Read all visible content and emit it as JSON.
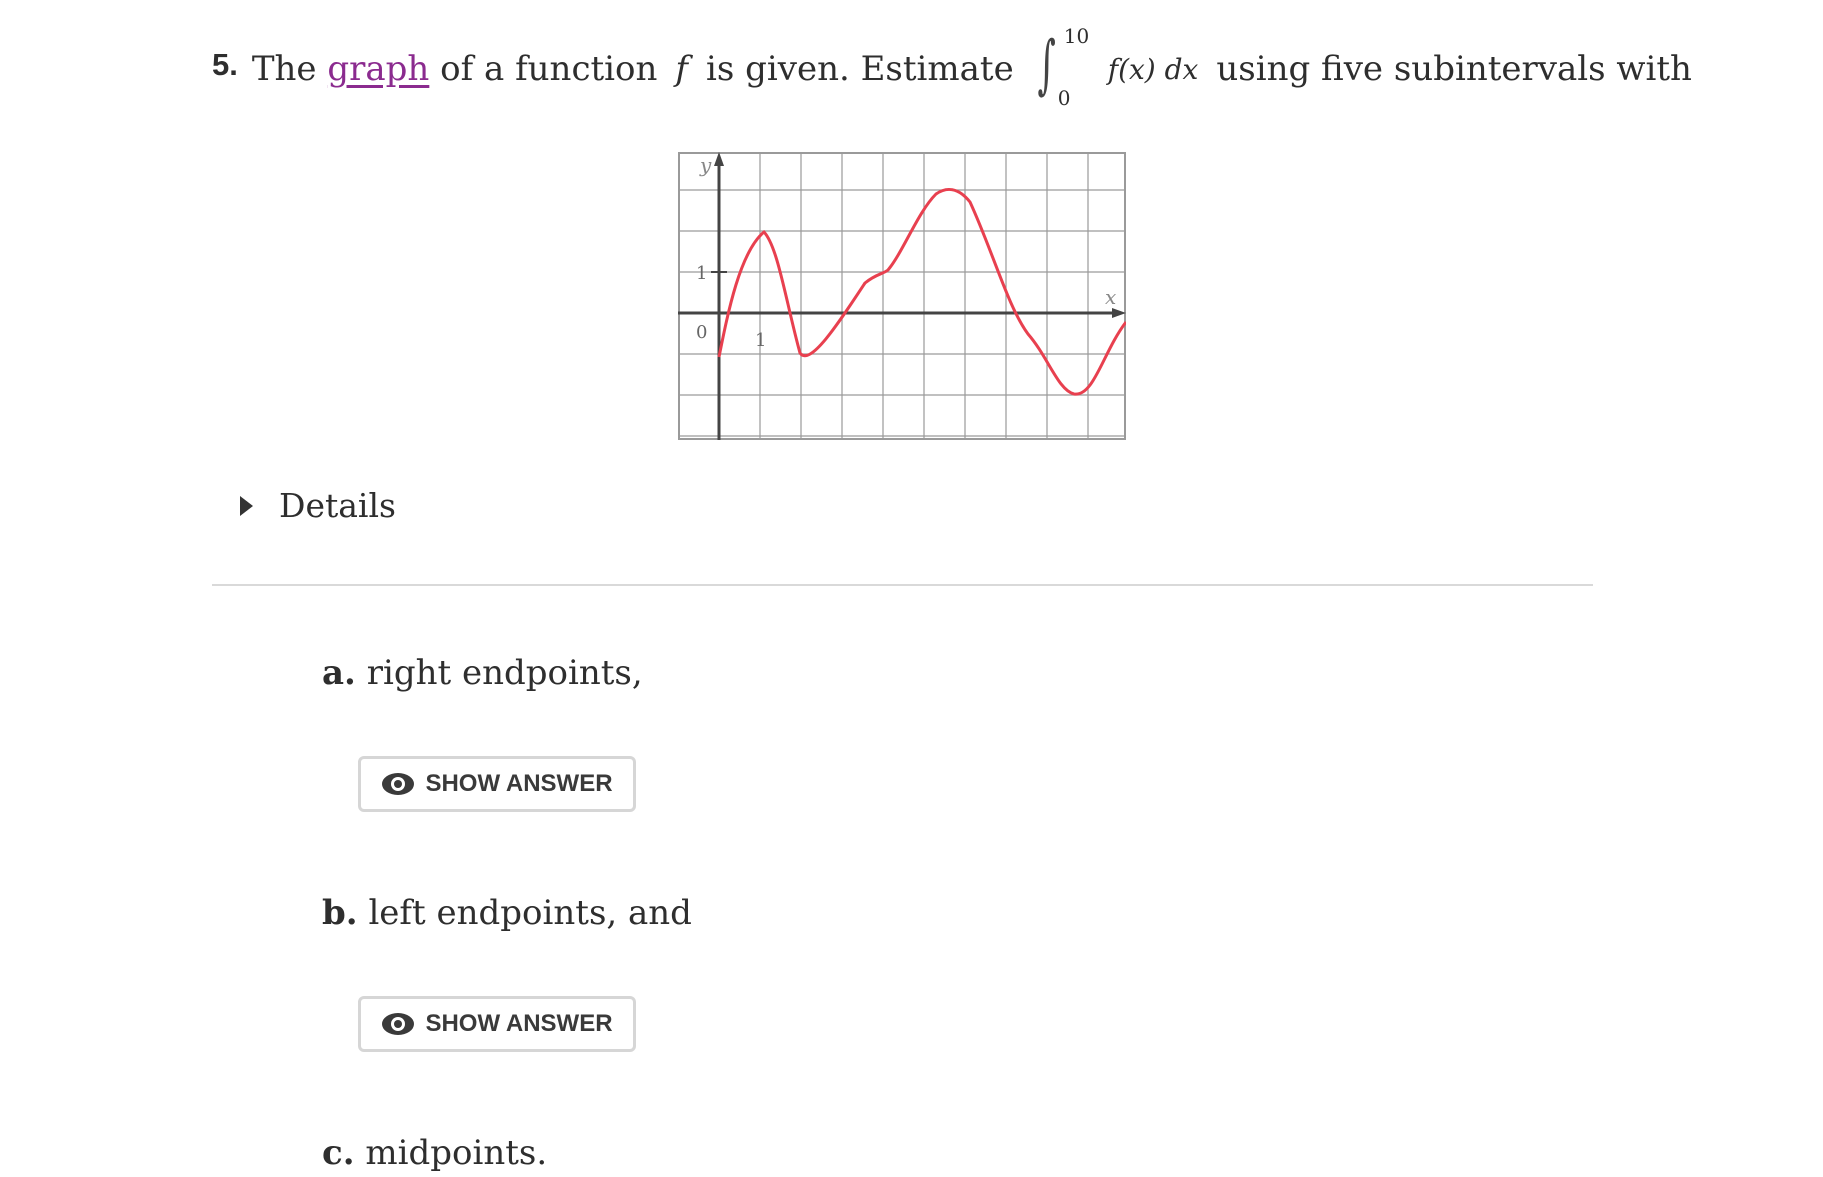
{
  "question": {
    "number": "5.",
    "text_before_link": "The",
    "link_text": "graph",
    "text_after_link": "of a function",
    "function_symbol": "f",
    "text_is_given": "is given. Estimate",
    "integral_upper": "10",
    "integral_lower": "0",
    "integrand": "f(x) dx",
    "text_end": "using five subintervals with"
  },
  "figure": {
    "y_axis_label": "y",
    "x_axis_label": "x",
    "y_tick_label": "1",
    "origin_label": "0",
    "x_tick_label": "1",
    "curve_color": "#e8404f",
    "grid_color": "#9a9a9a"
  },
  "details": {
    "label": "Details"
  },
  "parts": {
    "a": {
      "letter": "a.",
      "text": "right endpoints,"
    },
    "b": {
      "letter": "b.",
      "text": "left endpoints, and"
    },
    "c": {
      "letter": "c.",
      "text": "midpoints."
    }
  },
  "buttons": {
    "show_answer_label": "SHOW ANSWER"
  }
}
